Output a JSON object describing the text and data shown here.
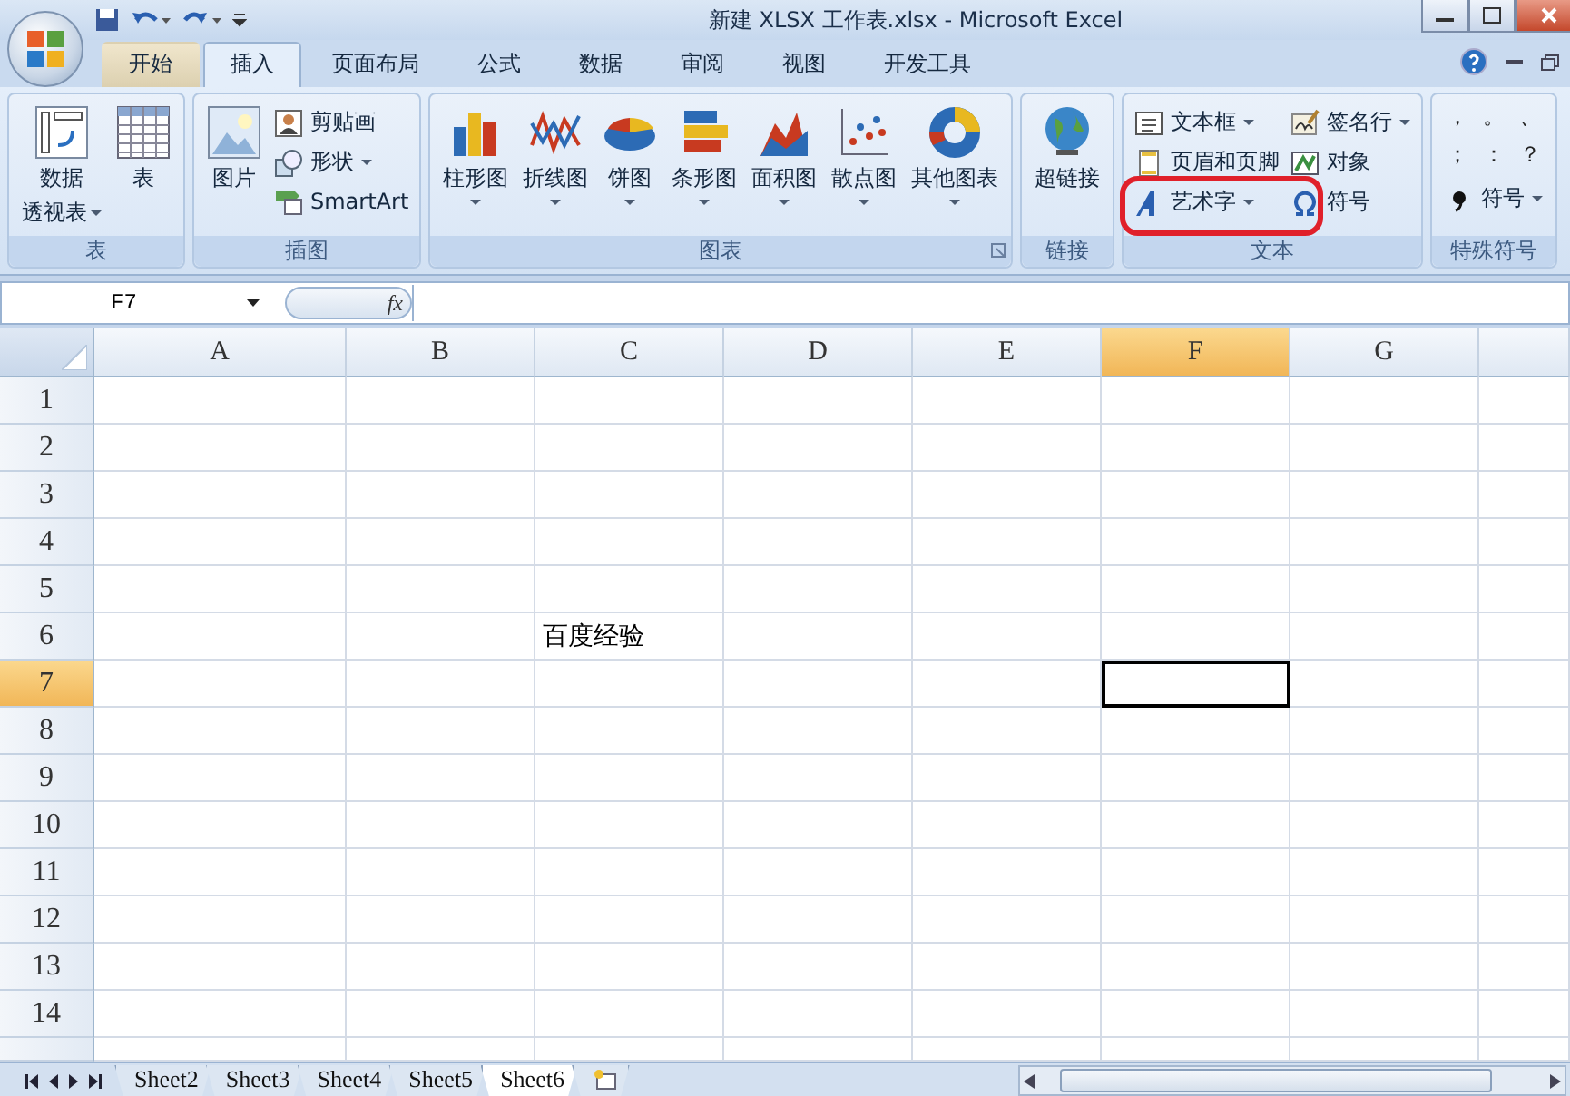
{
  "window": {
    "title": "新建 XLSX 工作表.xlsx - Microsoft Excel"
  },
  "ribbon_tabs": [
    {
      "label": "开始",
      "selected": false
    },
    {
      "label": "插入",
      "selected": true
    },
    {
      "label": "页面布局",
      "selected": false
    },
    {
      "label": "公式",
      "selected": false
    },
    {
      "label": "数据",
      "selected": false
    },
    {
      "label": "审阅",
      "selected": false
    },
    {
      "label": "视图",
      "selected": false
    },
    {
      "label": "开发工具",
      "selected": false
    }
  ],
  "ribbon_groups": [
    {
      "label": "表",
      "large": [
        {
          "label": "数据",
          "label_2": "透视表",
          "dropdown": true
        },
        {
          "label": "表",
          "dropdown": false
        }
      ]
    },
    {
      "label": "插图",
      "large": [
        {
          "label": "图片",
          "dropdown": false
        }
      ],
      "small_columns": [
        [
          {
            "label": "剪贴画",
            "dropdown": false
          },
          {
            "label": "形状",
            "dropdown": true
          },
          {
            "label": "SmartArt",
            "dropdown": false
          }
        ]
      ]
    },
    {
      "label": "图表",
      "launcher": true,
      "large": [
        {
          "label": "柱形图",
          "dropdown": true
        },
        {
          "label": "折线图",
          "dropdown": true
        },
        {
          "label": "饼图",
          "dropdown": true
        },
        {
          "label": "条形图",
          "dropdown": true
        },
        {
          "label": "面积图",
          "dropdown": true
        },
        {
          "label": "散点图",
          "dropdown": true
        },
        {
          "label": "其他图表",
          "dropdown": true
        }
      ]
    },
    {
      "label": "链接",
      "large": [
        {
          "label": "超链接",
          "dropdown": false
        }
      ]
    },
    {
      "label": "文本",
      "small_columns": [
        [
          {
            "label": "文本框",
            "dropdown": true
          },
          {
            "label": "页眉和页脚",
            "dropdown": false
          },
          {
            "label": "艺术字",
            "dropdown": true,
            "highlighted": true
          }
        ],
        [
          {
            "label": "签名行",
            "dropdown": true
          },
          {
            "label": "对象",
            "dropdown": false
          },
          {
            "label": "符号",
            "dropdown": false
          }
        ]
      ]
    },
    {
      "label": "特殊符号",
      "symbols": [
        "，",
        "。",
        "、",
        "；",
        "：",
        "？"
      ],
      "small_columns": [
        [
          {
            "label": "符号",
            "dropdown": true
          }
        ]
      ]
    }
  ],
  "formula_bar": {
    "name_box": "F7",
    "function_label": "fx"
  },
  "columns": [
    {
      "label": "A",
      "selected": false
    },
    {
      "label": "B",
      "selected": false
    },
    {
      "label": "C",
      "selected": false
    },
    {
      "label": "D",
      "selected": false
    },
    {
      "label": "E",
      "selected": false
    },
    {
      "label": "F",
      "selected": true
    },
    {
      "label": "G",
      "selected": false
    }
  ],
  "rows": [
    {
      "label": "1",
      "selected": false,
      "cells": []
    },
    {
      "label": "2",
      "selected": false,
      "cells": []
    },
    {
      "label": "3",
      "selected": false,
      "cells": []
    },
    {
      "label": "4",
      "selected": false,
      "cells": []
    },
    {
      "label": "5",
      "selected": false,
      "cells": []
    },
    {
      "label": "6",
      "selected": false,
      "cells": [
        null,
        null,
        {
          "text": "百度经验",
          "selected": false
        }
      ]
    },
    {
      "label": "7",
      "selected": true,
      "cells": [
        null,
        null,
        null,
        null,
        null,
        {
          "selected": true
        }
      ]
    },
    {
      "label": "8",
      "selected": false,
      "cells": []
    },
    {
      "label": "9",
      "selected": false,
      "cells": []
    },
    {
      "label": "10",
      "selected": false,
      "cells": []
    },
    {
      "label": "11",
      "selected": false,
      "cells": []
    },
    {
      "label": "12",
      "selected": false,
      "cells": []
    },
    {
      "label": "13",
      "selected": false,
      "cells": []
    },
    {
      "label": "14",
      "selected": false,
      "cells": []
    }
  ],
  "sheet_tabs": [
    {
      "label": "Sheet2",
      "selected": false
    },
    {
      "label": "Sheet3",
      "selected": false
    },
    {
      "label": "Sheet4",
      "selected": false
    },
    {
      "label": "Sheet5",
      "selected": false
    },
    {
      "label": "Sheet6",
      "selected": true
    }
  ]
}
